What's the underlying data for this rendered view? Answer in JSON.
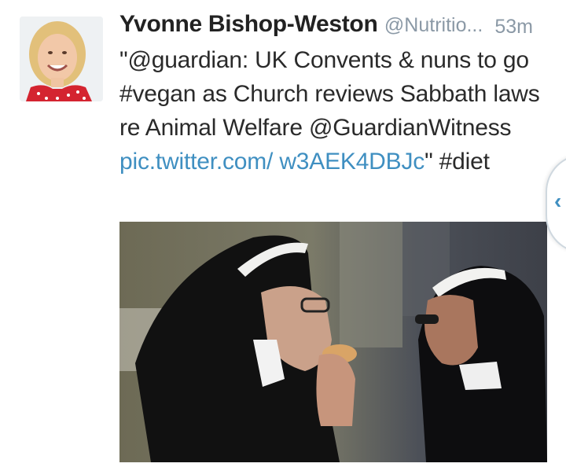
{
  "tweet": {
    "author_name": "Yvonne Bishop-Weston",
    "author_handle": "@Nutritio...",
    "timestamp": "53m",
    "text_part1": "\"@guardian: UK Convents & nuns to go #vegan as Church reviews Sabbath laws re Animal Welfare @GuardianWitness ",
    "link_text": "pic.twitter.com/ w3AEK4DBJc",
    "text_part2": "\" #diet",
    "link_color": "#3f8fc1"
  },
  "icons": {
    "edge_tab": "chevron-left-icon",
    "edge_tab_glyph": "‹"
  }
}
